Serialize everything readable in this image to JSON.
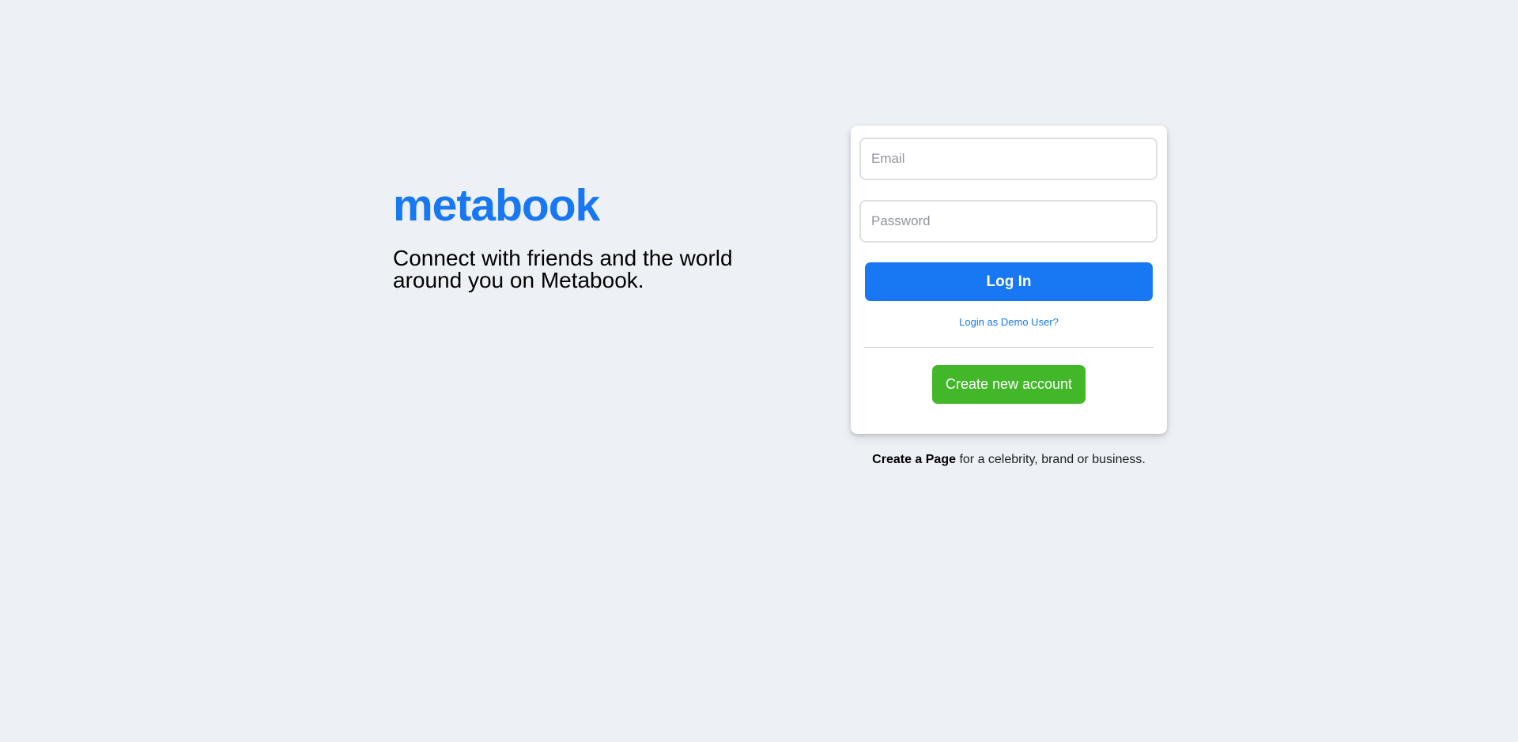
{
  "brand": {
    "logo_text": "metabook",
    "tagline": "Connect with friends and the world around you on Metabook."
  },
  "login_form": {
    "email_placeholder": "Email",
    "email_value": "",
    "password_placeholder": "Password",
    "password_value": "",
    "login_button_label": "Log In",
    "demo_link_label": "Login as Demo User?",
    "create_account_button_label": "Create new account"
  },
  "footer_note": {
    "link_text": "Create a Page",
    "rest_text": " for a celebrity, brand or business."
  },
  "colors": {
    "brand_blue": "#1877f2",
    "create_green": "#42b72a",
    "background": "#edf1f5"
  }
}
